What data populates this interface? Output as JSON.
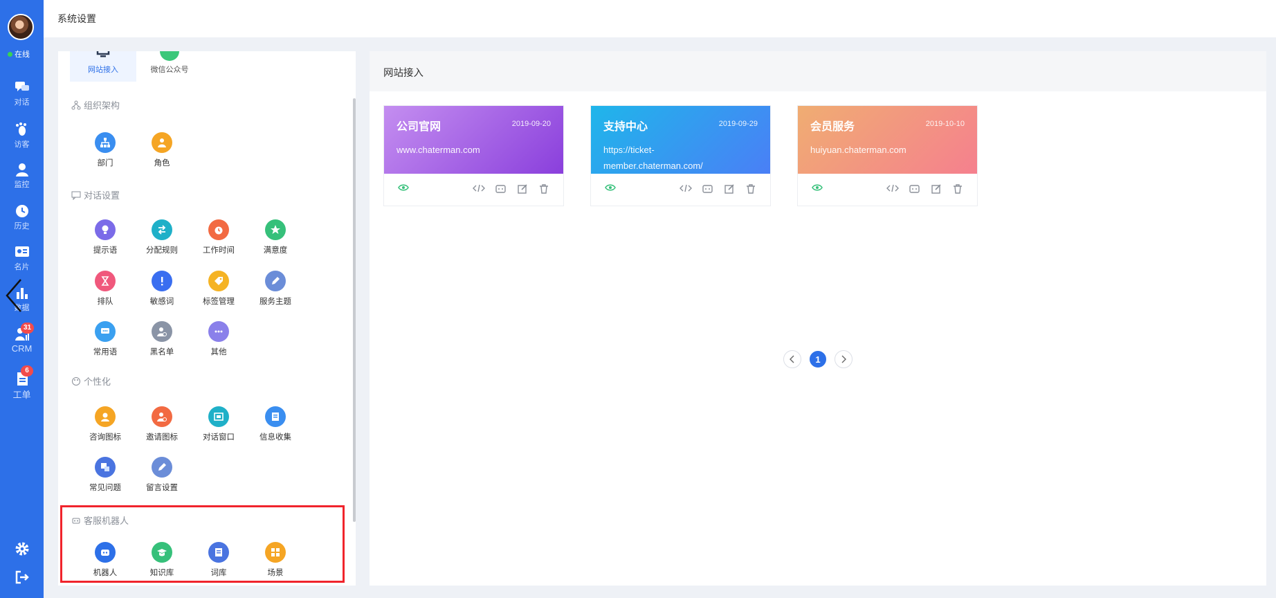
{
  "rail": {
    "status": "在线",
    "items": [
      {
        "label": "对话"
      },
      {
        "label": "访客"
      },
      {
        "label": "监控"
      },
      {
        "label": "历史"
      },
      {
        "label": "名片"
      },
      {
        "label": "数据"
      },
      {
        "label": "CRM",
        "badge": "31"
      },
      {
        "label": "工单",
        "badge": "6"
      }
    ]
  },
  "header": {
    "title": "系统设置"
  },
  "settings": {
    "channels": [
      {
        "label": "网站接入"
      },
      {
        "label": "微信公众号"
      }
    ],
    "sections": [
      {
        "title": "组织架构",
        "items": [
          "部门",
          "角色"
        ]
      },
      {
        "title": "对话设置",
        "items": [
          "提示语",
          "分配规则",
          "工作时间",
          "满意度",
          "排队",
          "敏感词",
          "标签管理",
          "服务主题",
          "常用语",
          "黑名单",
          "其他"
        ]
      },
      {
        "title": "个性化",
        "items": [
          "咨询图标",
          "邀请图标",
          "对话窗口",
          "信息收集",
          "常见问题",
          "留言设置"
        ]
      },
      {
        "title": "客服机器人",
        "items": [
          "机器人",
          "知识库",
          "词库",
          "场景"
        ]
      }
    ]
  },
  "main": {
    "title": "网站接入",
    "sites": [
      {
        "name": "公司官网",
        "date": "2019-09-20",
        "url_lines": [
          "www.chaterman.com"
        ],
        "gradient": [
          "#c48ef0",
          "#8a3fdc"
        ]
      },
      {
        "name": "支持中心",
        "date": "2019-09-29",
        "url_lines": [
          "https://ticket-",
          "member.chaterman.com/"
        ],
        "gradient": [
          "#1fb6ea",
          "#4a7ff6"
        ]
      },
      {
        "name": "会员服务",
        "date": "2019-10-10",
        "url_lines": [
          "huiyuan.chaterman.com"
        ],
        "gradient": [
          "#f0ad72",
          "#f5808e"
        ]
      }
    ],
    "pagination": {
      "current": "1"
    }
  },
  "colors": {
    "accent": "#2d70e8",
    "highlight": "#f0242c"
  }
}
